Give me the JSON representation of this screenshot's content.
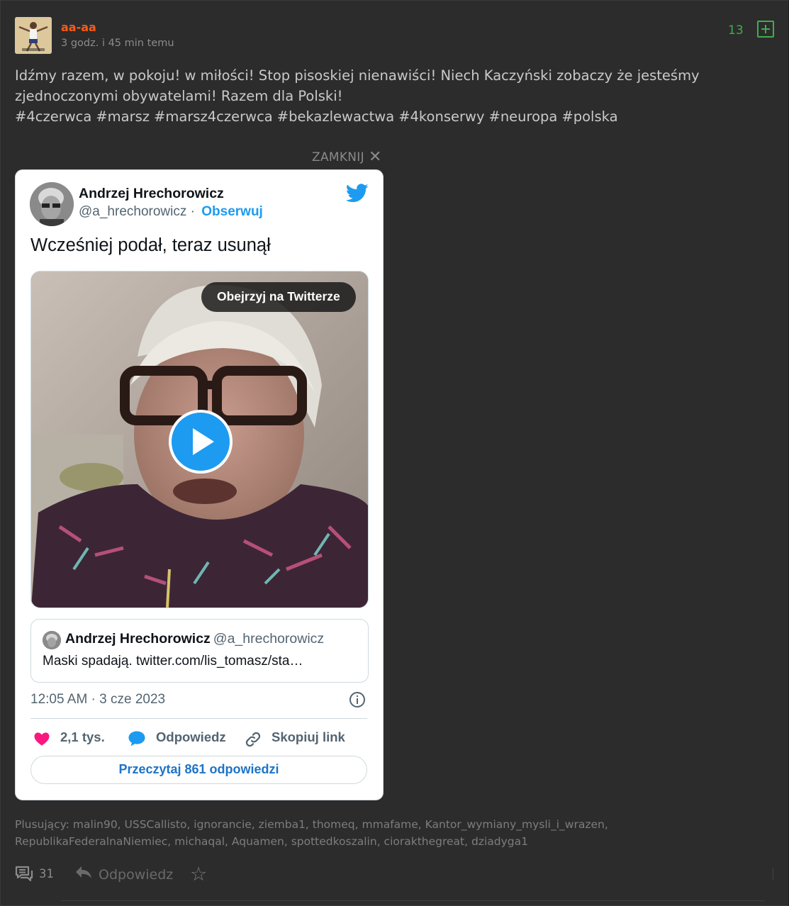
{
  "entry": {
    "username": "aa-aa",
    "time": "3 godz. i 45 min temu",
    "votes": "13",
    "text_lines": [
      "Idźmy razem, w pokoju! w miłości! Stop pisoskiej nienawiści! Niech Kaczyński zobaczy że jesteśmy",
      "zjednoczonymi obywatelami! Razem dla Polski!"
    ],
    "tags": [
      "#4czerwca",
      "#marsz",
      "#marsz4czerwca",
      "#bekazlewactwa",
      "#4konserwy",
      "#neuropa",
      "#polska"
    ],
    "close_label": "ZAMKNIJ",
    "close_icon": "✕"
  },
  "tweet": {
    "author_name": "Andrzej Hrechorowicz",
    "author_handle": "@a_hrechorowicz",
    "separator": "·",
    "follow_label": "Obserwuj",
    "text": "Wcześniej podał, teraz usunął",
    "watch_label": "Obejrzyj na Twitterze",
    "quote": {
      "name": "Andrzej Hrechorowicz",
      "handle": "@a_hrechorowicz",
      "text": "Maski spadają. twitter.com/lis_tomasz/sta…"
    },
    "date": "12:05 AM · 3 cze 2023",
    "likes": "2,1 tys.",
    "reply_label": "Odpowiedz",
    "copy_label": "Skopiuj link",
    "read_replies_label": "Przeczytaj 861 odpowiedzi",
    "colors": {
      "accent": "#1d9bf0",
      "like": "#f91880",
      "link": "#1d74c8"
    }
  },
  "footer": {
    "voters_label": "Plusujący:",
    "voters": "malin90, USSCallisto, ignorancie, ziemba1, thomeq, mmafame, Kantor_wymiany_mysli_i_wrazen, RepublikaFederalnaNiemiec, michaqal, Aquamen, spottedkoszalin, ciorakthegreat, dziadyga1",
    "comments_count": "31",
    "reply_label": "Odpowiedz",
    "star_icon": "☆"
  },
  "colors": {
    "background": "#2c2c2c",
    "username": "#ff5917",
    "vote_green": "#3fae4c"
  }
}
